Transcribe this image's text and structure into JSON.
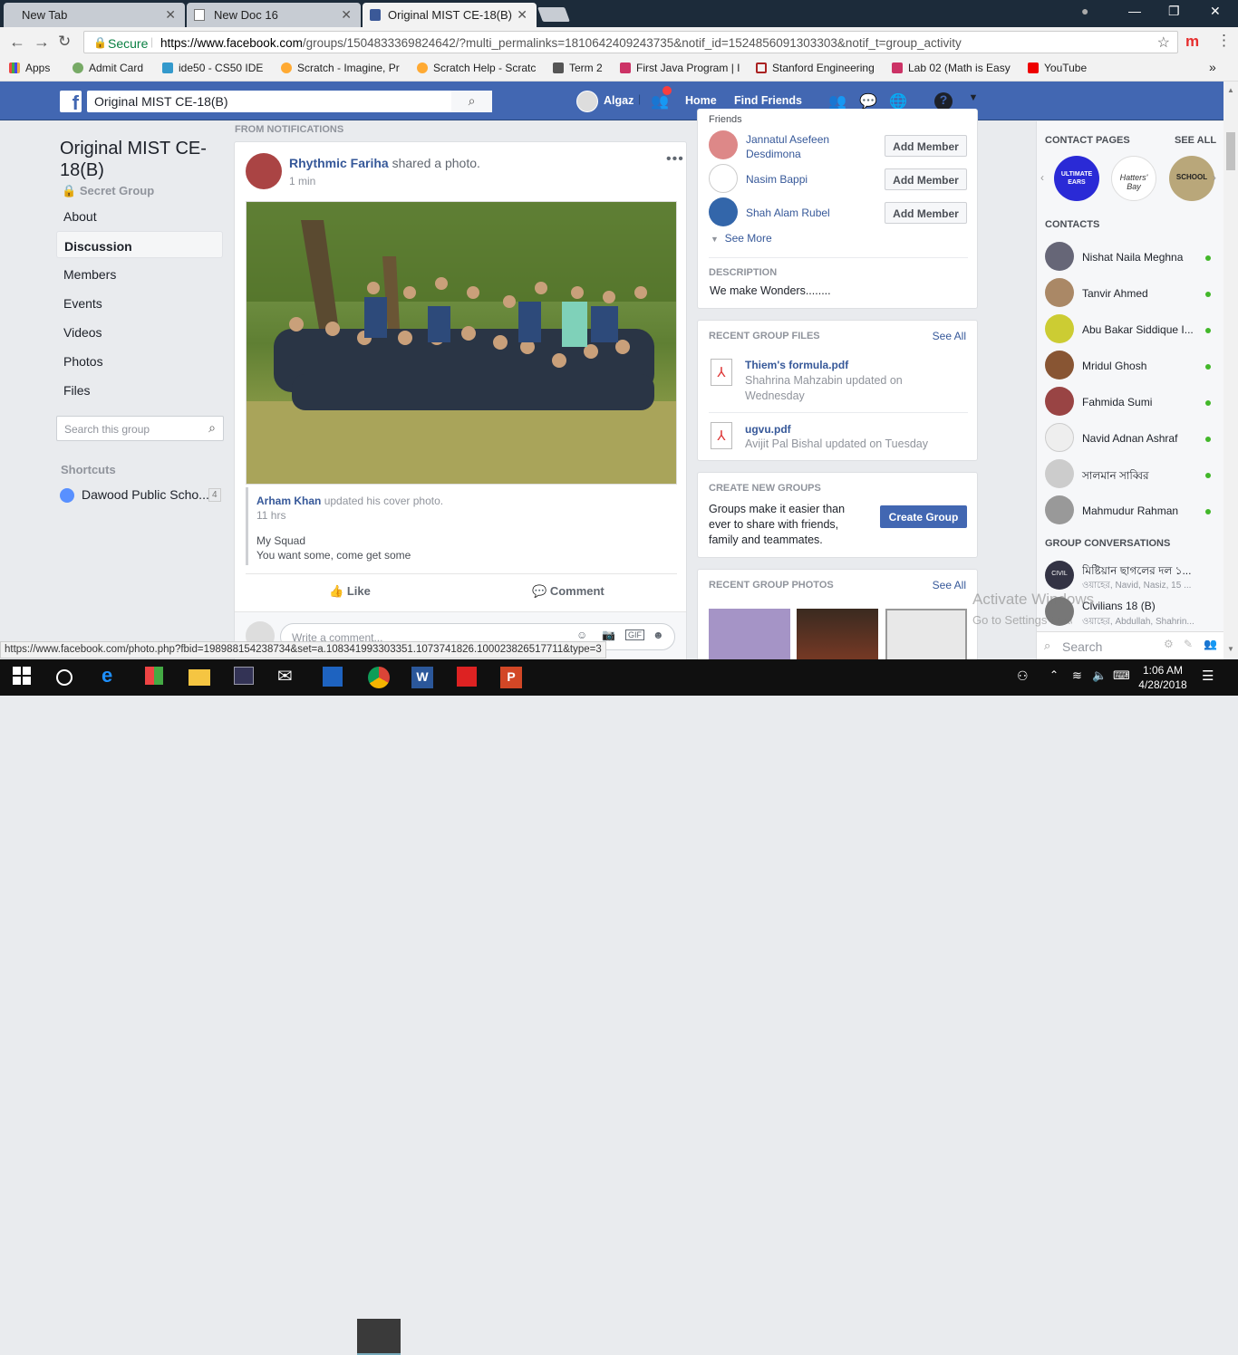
{
  "tabs": [
    {
      "label": "New Tab"
    },
    {
      "label": "New Doc 16"
    },
    {
      "label": "Original MIST CE-18(B)"
    }
  ],
  "omnibox": {
    "secure_label": "Secure",
    "url_prefix": "https://www.facebook.com",
    "url_rest": "/groups/1504833369824642/?multi_permalinks=1810642409243735&notif_id=1524856091303303&notif_t=group_activity"
  },
  "bookmarks": [
    {
      "label": "Apps"
    },
    {
      "label": "Admit Card"
    },
    {
      "label": "ide50 - CS50 IDE"
    },
    {
      "label": "Scratch - Imagine, Pr"
    },
    {
      "label": "Scratch Help - Scratc"
    },
    {
      "label": "Term 2"
    },
    {
      "label": "First Java Program | I"
    },
    {
      "label": "Stanford Engineering"
    },
    {
      "label": "Lab 02 (Math is Easy"
    },
    {
      "label": "YouTube"
    }
  ],
  "fb_header": {
    "search_value": "Original MIST CE-18(B)",
    "user_name": "Algaz",
    "home": "Home",
    "find_friends": "Find Friends"
  },
  "group": {
    "name": "Original MIST CE-18(B)",
    "privacy": "Secret Group",
    "nav": [
      "About",
      "Discussion",
      "Members",
      "Events",
      "Videos",
      "Photos",
      "Files"
    ],
    "search_placeholder": "Search this group",
    "shortcuts_title": "Shortcuts",
    "shortcut": "Dawood Public Scho...",
    "shortcut_count": "4"
  },
  "feed": {
    "section_label": "FROM NOTIFICATIONS",
    "post_author": "Rhythmic Fariha",
    "post_action": "shared a photo.",
    "post_time": "1 min",
    "orig_author": "Arham Khan",
    "orig_action": "updated his cover photo.",
    "orig_time": "11 hrs",
    "caption1": "My Squad",
    "caption2": "You want some, come get some",
    "like": "Like",
    "comment": "Comment",
    "comment_placeholder": "Write a comment..."
  },
  "right_panel": {
    "friends_label": "Friends",
    "suggestions": [
      {
        "name": "Jannatul Asefeen Desdimona",
        "button": "Add Member"
      },
      {
        "name": "Nasim Bappi",
        "button": "Add Member"
      },
      {
        "name": "Shah Alam Rubel",
        "button": "Add Member"
      }
    ],
    "see_more": "See More",
    "description_title": "DESCRIPTION",
    "description": "We make Wonders........",
    "files_title": "RECENT GROUP FILES",
    "see_all": "See All",
    "files": [
      {
        "name": "Thiem's formula.pdf",
        "meta": "Shahrina Mahzabin updated on Wednesday"
      },
      {
        "name": "ugvu.pdf",
        "meta": "Avijit Pal Bishal updated on Tuesday"
      }
    ],
    "create_title": "CREATE NEW GROUPS",
    "create_text": "Groups make it easier than ever to share with friends, family and teammates.",
    "create_button": "Create Group",
    "photos_title": "RECENT GROUP PHOTOS"
  },
  "chat": {
    "contact_pages": "CONTACT PAGES",
    "see_all": "SEE ALL",
    "pages": [
      "ULTIMATE EARS",
      "Hatters' Bay",
      "SCHOOL"
    ],
    "contacts_title": "CONTACTS",
    "contacts": [
      "Nishat Naila Meghna",
      "Tanvir Ahmed",
      "Abu Bakar Siddique I...",
      "Mridul Ghosh",
      "Fahmida Sumi",
      "Navid Adnan Ashraf",
      "সালমান সাব্বির",
      "Mahmudur Rahman"
    ],
    "group_conv_title": "GROUP CONVERSATIONS",
    "conversations": [
      {
        "name": "মিষ্টিয়ান ছাগলের দল ১...",
        "sub": "ওয়াহের, Navid, Nasiz, 15 ..."
      },
      {
        "name": "Civilians 18 (B)",
        "sub": "ওয়াহের, Abdullah, Shahrin..."
      }
    ],
    "search_placeholder": "Search"
  },
  "watermark": {
    "line1": "Activate Windows",
    "line2": "Go to Settings to activate Windows."
  },
  "status_url": "https://www.facebook.com/photo.php?fbid=198988154238734&set=a.108341993303351.1073741826.100023826517711&type=3",
  "taskbar": {
    "time": "1:06 AM",
    "date": "4/28/2018"
  },
  "colors": {
    "fb_blue": "#4267b2",
    "link": "#365899",
    "online": "#42b72a"
  }
}
